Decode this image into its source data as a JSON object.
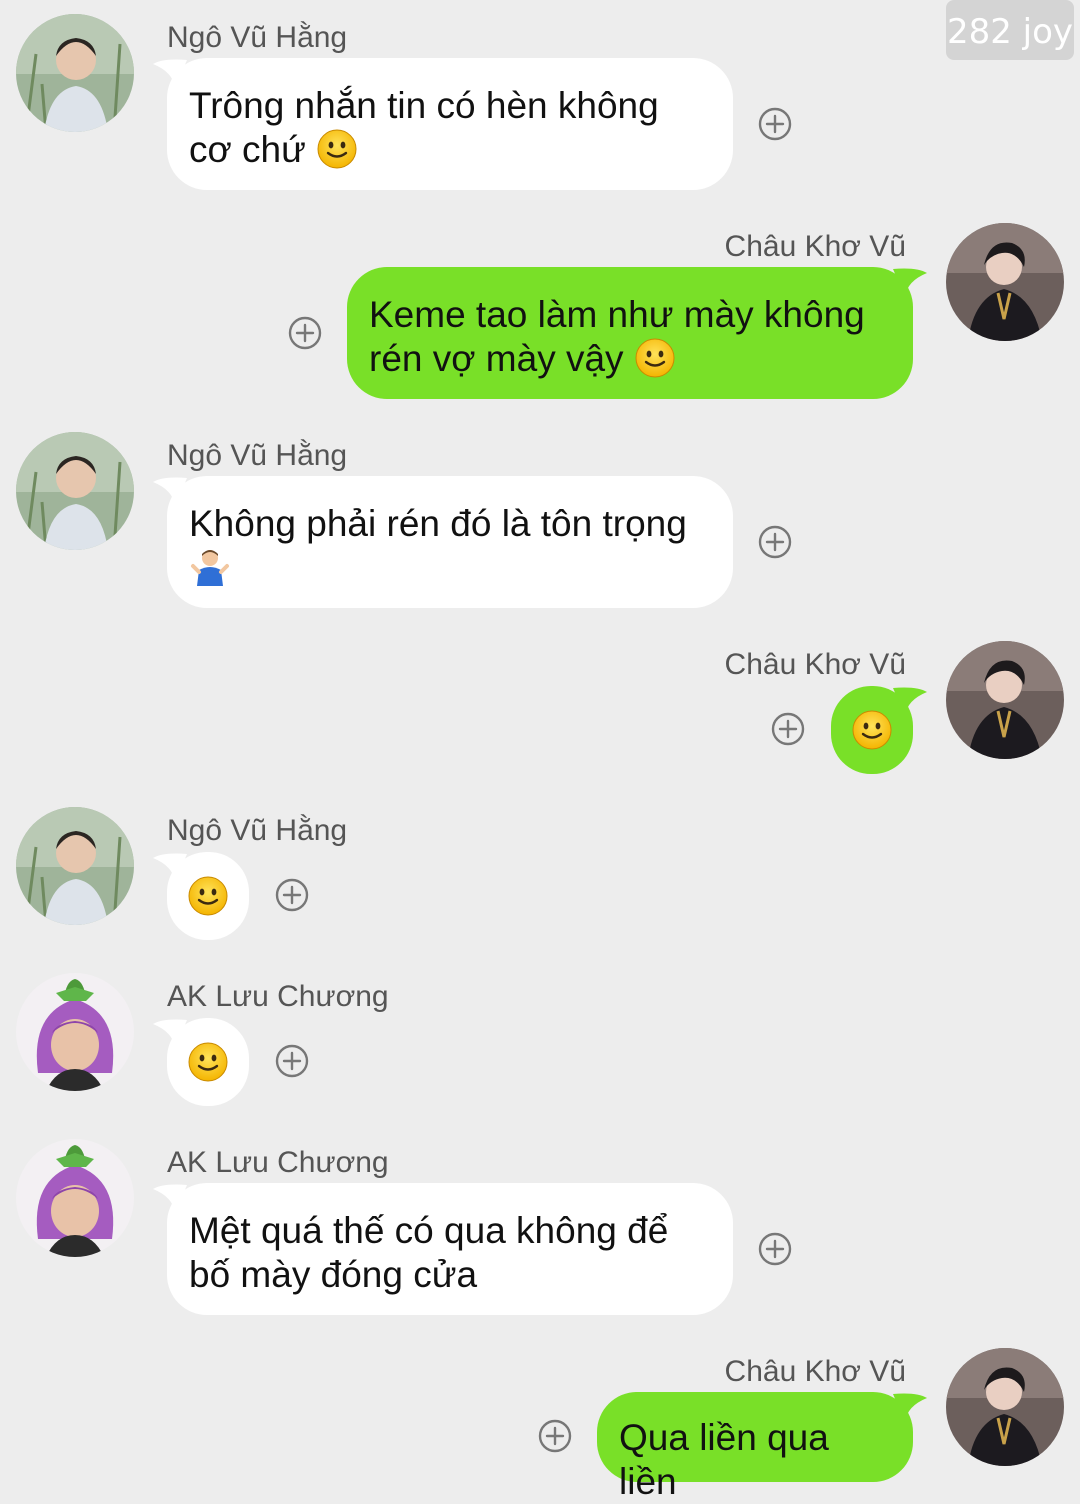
{
  "watermark": "282 joy",
  "messages": [
    {
      "sender": "Ngô Vũ Hằng",
      "text": "Trông nhắn tin có hèn không cơ chứ",
      "emoji": "slightly-smiling-face-icon"
    },
    {
      "sender": "Châu Khơ Vũ",
      "text": "Keme tao làm như mày không rén vợ mày vậy",
      "emoji": "slightly-smiling-face-icon"
    },
    {
      "sender": "Ngô Vũ Hằng",
      "text": "Không phải rén đó là tôn trọng",
      "emoji": "person-shrugging-icon"
    },
    {
      "sender": "Châu Khơ Vũ",
      "text": "",
      "emoji": "slightly-smiling-face-icon"
    },
    {
      "sender": "Ngô Vũ Hằng",
      "text": "",
      "emoji": "slightly-smiling-face-icon"
    },
    {
      "sender": "AK Lưu Chương",
      "text": "",
      "emoji": "slightly-smiling-face-icon"
    },
    {
      "sender": "AK Lưu Chương",
      "text": "Mệt quá thế có qua không để bố mày đóng cửa",
      "emoji": ""
    },
    {
      "sender": "Châu Khơ Vũ",
      "text": "Qua liền qua liền",
      "emoji": ""
    }
  ],
  "colors": {
    "background": "#ededed",
    "incoming_bubble": "#ffffff",
    "outgoing_bubble": "#79e028"
  }
}
